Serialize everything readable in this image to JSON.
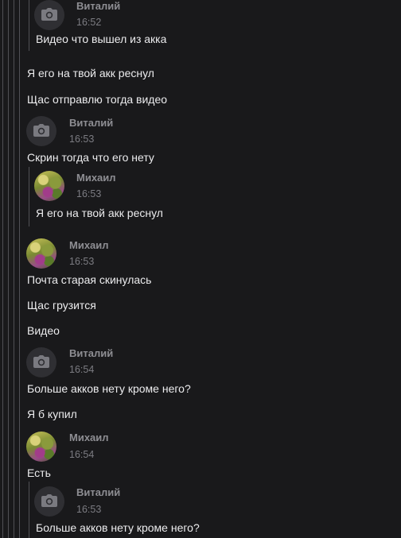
{
  "messages": [
    {
      "author": "Виталий",
      "time": "16:52",
      "texts": [
        "Видео что вышел из акка"
      ]
    },
    {
      "texts": [
        "Я его на твой акк реснул",
        "Щас отправлю тогда видео"
      ]
    },
    {
      "author": "Виталий",
      "time": "16:53",
      "texts": [
        "Скрин тогда что его нету"
      ]
    },
    {
      "author": "Михаил",
      "time": "16:53",
      "texts": [
        "Я его на твой акк реснул"
      ]
    },
    {
      "author": "Михаил",
      "time": "16:53",
      "texts": [
        "Почта старая скинулась",
        "Щас грузится",
        "Видео"
      ]
    },
    {
      "author": "Виталий",
      "time": "16:54",
      "texts": [
        "Больше акков нету кроме него?",
        "Я б купил"
      ]
    },
    {
      "author": "Михаил",
      "time": "16:54",
      "texts": [
        "Есть"
      ]
    },
    {
      "author": "Виталий",
      "time": "16:53",
      "texts": [
        "Больше акков нету кроме него?"
      ]
    }
  ]
}
